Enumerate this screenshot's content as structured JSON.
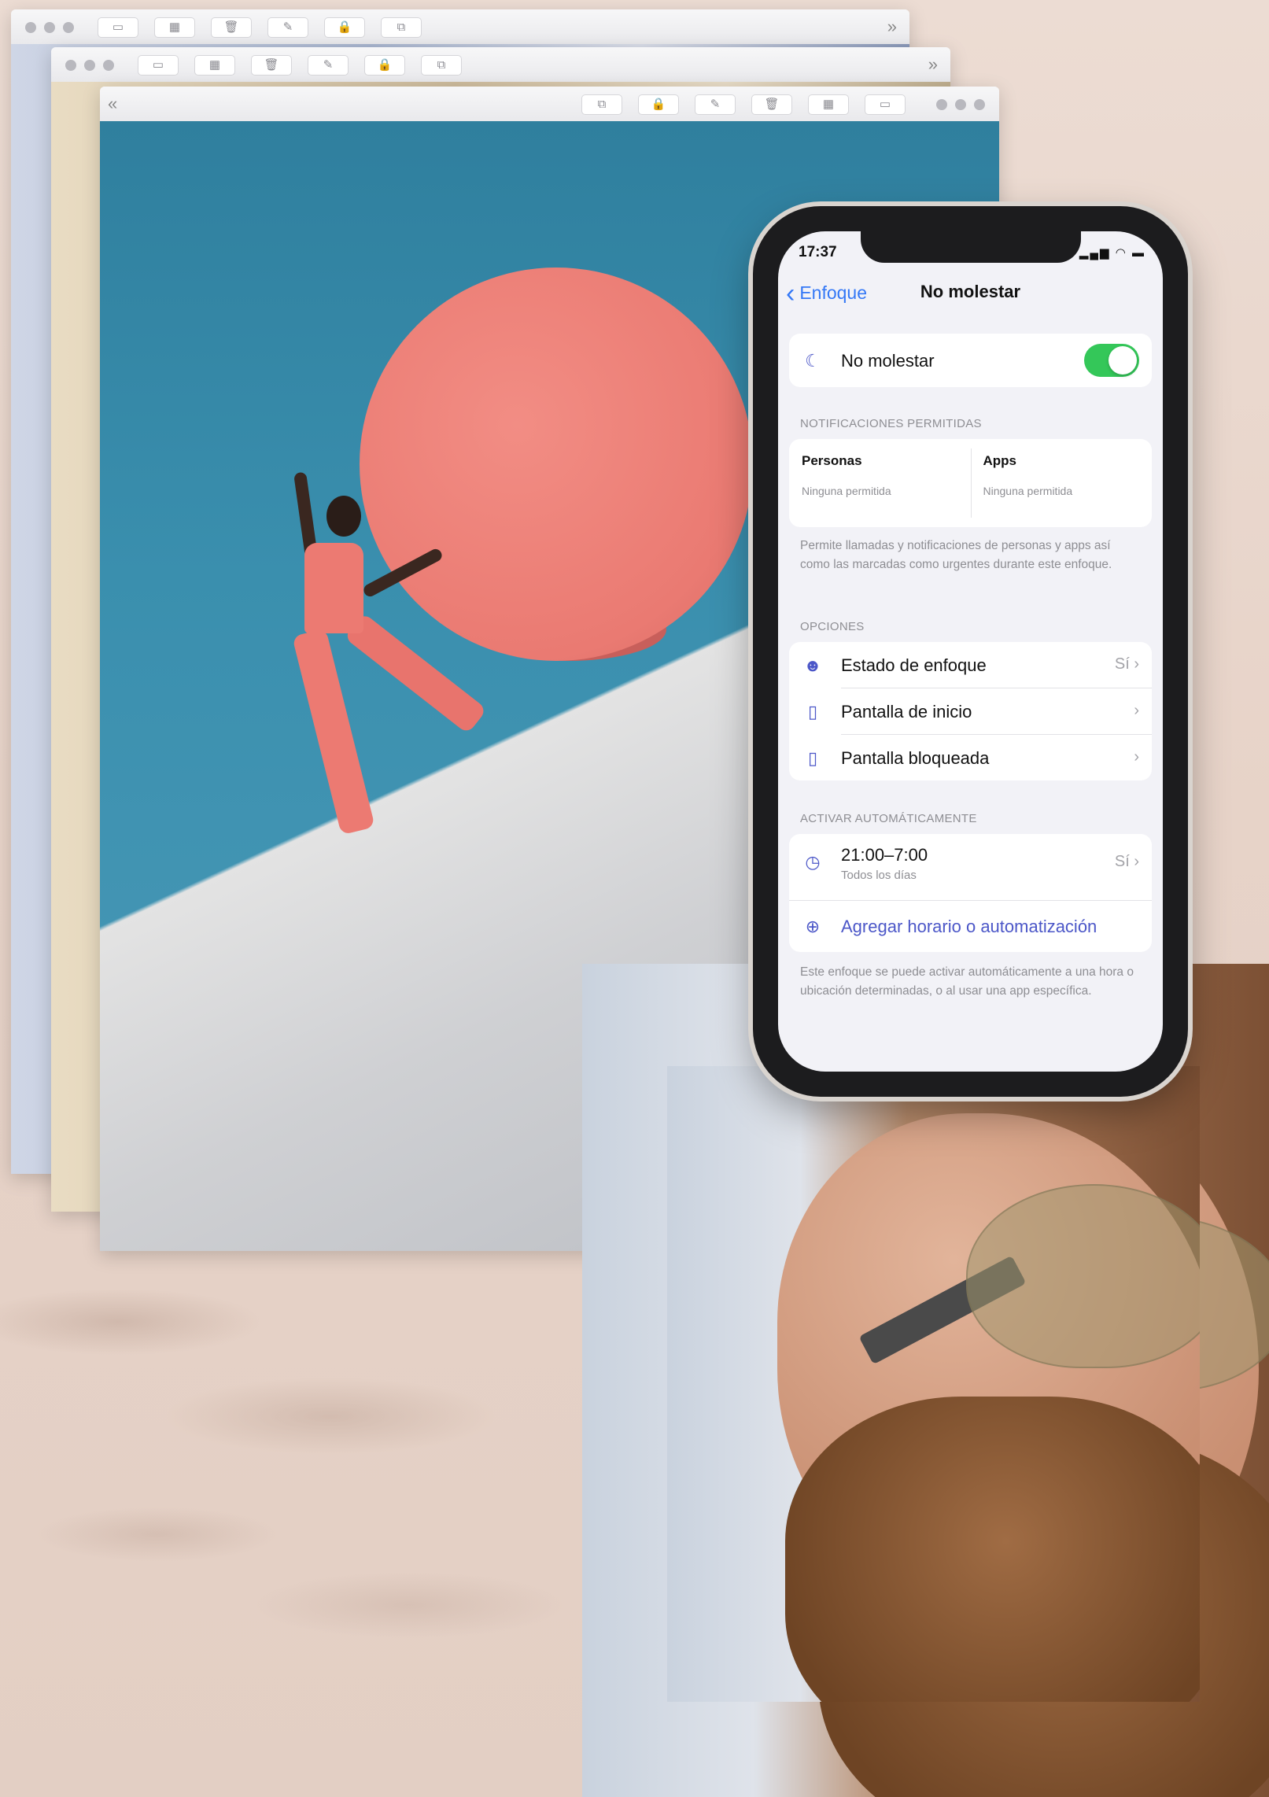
{
  "window_back": {
    "forward_chevron": "»",
    "buttons": [
      "sidebar-icon",
      "grid-icon",
      "trash-icon",
      "compose-icon",
      "lock-icon",
      "share-icon"
    ]
  },
  "window_mid": {
    "forward_chevron": "»"
  },
  "window_front": {
    "back_chevron": "«"
  },
  "phone": {
    "status": {
      "time": "17:37",
      "icons": "▂▄▆ ◠ ▬"
    },
    "nav": {
      "back_label": "Enfoque",
      "title": "No molestar"
    },
    "focus_toggle": {
      "label": "No molestar",
      "on": true
    },
    "notifications": {
      "section": "NOTIFICACIONES PERMITIDAS",
      "people": {
        "title": "Personas",
        "subtitle": "Ninguna permitida"
      },
      "apps": {
        "title": "Apps",
        "subtitle": "Ninguna permitida"
      },
      "note": "Permite llamadas y notificaciones de personas y apps así como las marcadas como urgentes durante este enfoque."
    },
    "options": {
      "section": "OPCIONES",
      "items": [
        {
          "label": "Estado de enfoque",
          "value": "Sí"
        },
        {
          "label": "Pantalla de inicio",
          "value": ""
        },
        {
          "label": "Pantalla bloqueada",
          "value": ""
        }
      ]
    },
    "auto": {
      "section": "ACTIVAR AUTOMÁTICAMENTE",
      "schedule": {
        "label": "21:00–7:00",
        "sub": "Todos los días",
        "value": "Sí"
      },
      "add_label": "Agregar horario o automatización",
      "note": "Este enfoque se puede activar automáticamente a una hora o ubicación determinadas, o al usar una app específica."
    },
    "accent": "#3478f6",
    "toggle_color": "#34c759"
  }
}
